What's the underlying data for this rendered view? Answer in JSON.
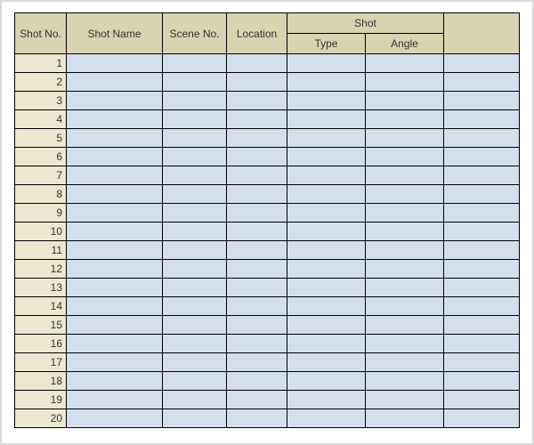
{
  "headers": {
    "shot_no": "Shot No.",
    "shot_name": "Shot Name",
    "scene_no": "Scene No.",
    "location": "Location",
    "shot_group": "Shot",
    "shot_type": "Type",
    "shot_angle": "Angle"
  },
  "rows": [
    {
      "no": "1",
      "name": "",
      "scene": "",
      "location": "",
      "type": "",
      "angle": "",
      "extra": ""
    },
    {
      "no": "2",
      "name": "",
      "scene": "",
      "location": "",
      "type": "",
      "angle": "",
      "extra": ""
    },
    {
      "no": "3",
      "name": "",
      "scene": "",
      "location": "",
      "type": "",
      "angle": "",
      "extra": ""
    },
    {
      "no": "4",
      "name": "",
      "scene": "",
      "location": "",
      "type": "",
      "angle": "",
      "extra": ""
    },
    {
      "no": "5",
      "name": "",
      "scene": "",
      "location": "",
      "type": "",
      "angle": "",
      "extra": ""
    },
    {
      "no": "6",
      "name": "",
      "scene": "",
      "location": "",
      "type": "",
      "angle": "",
      "extra": ""
    },
    {
      "no": "7",
      "name": "",
      "scene": "",
      "location": "",
      "type": "",
      "angle": "",
      "extra": ""
    },
    {
      "no": "8",
      "name": "",
      "scene": "",
      "location": "",
      "type": "",
      "angle": "",
      "extra": ""
    },
    {
      "no": "9",
      "name": "",
      "scene": "",
      "location": "",
      "type": "",
      "angle": "",
      "extra": ""
    },
    {
      "no": "10",
      "name": "",
      "scene": "",
      "location": "",
      "type": "",
      "angle": "",
      "extra": ""
    },
    {
      "no": "11",
      "name": "",
      "scene": "",
      "location": "",
      "type": "",
      "angle": "",
      "extra": ""
    },
    {
      "no": "12",
      "name": "",
      "scene": "",
      "location": "",
      "type": "",
      "angle": "",
      "extra": ""
    },
    {
      "no": "13",
      "name": "",
      "scene": "",
      "location": "",
      "type": "",
      "angle": "",
      "extra": ""
    },
    {
      "no": "14",
      "name": "",
      "scene": "",
      "location": "",
      "type": "",
      "angle": "",
      "extra": ""
    },
    {
      "no": "15",
      "name": "",
      "scene": "",
      "location": "",
      "type": "",
      "angle": "",
      "extra": ""
    },
    {
      "no": "16",
      "name": "",
      "scene": "",
      "location": "",
      "type": "",
      "angle": "",
      "extra": ""
    },
    {
      "no": "17",
      "name": "",
      "scene": "",
      "location": "",
      "type": "",
      "angle": "",
      "extra": ""
    },
    {
      "no": "18",
      "name": "",
      "scene": "",
      "location": "",
      "type": "",
      "angle": "",
      "extra": ""
    },
    {
      "no": "19",
      "name": "",
      "scene": "",
      "location": "",
      "type": "",
      "angle": "",
      "extra": ""
    },
    {
      "no": "20",
      "name": "",
      "scene": "",
      "location": "",
      "type": "",
      "angle": "",
      "extra": ""
    }
  ]
}
